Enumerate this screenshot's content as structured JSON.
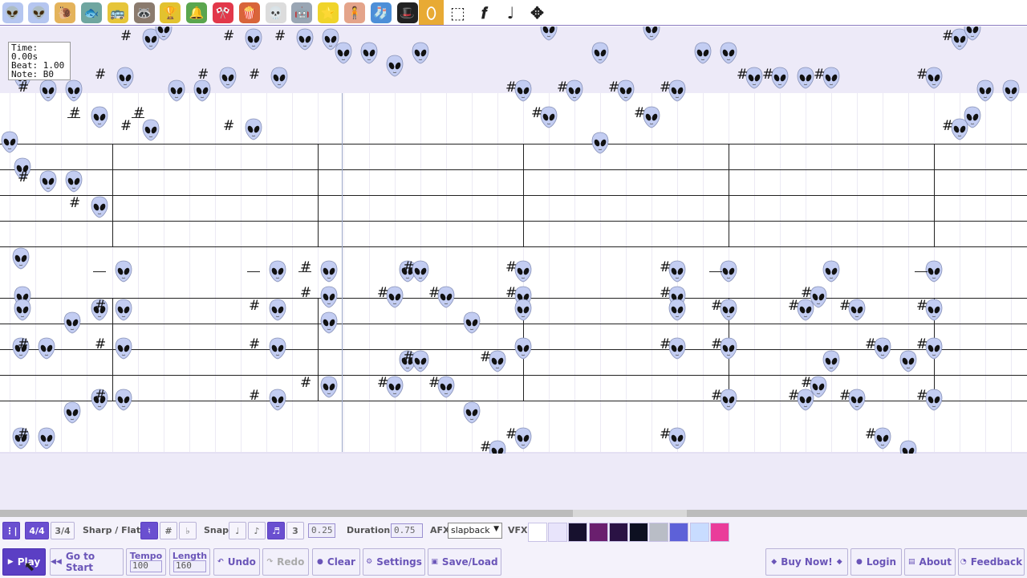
{
  "toolbar": {
    "instruments": [
      {
        "name": "alien-icon",
        "glyph": "👽",
        "color": "#b5c6f0"
      },
      {
        "name": "alien-icon",
        "glyph": "👽",
        "color": "#b5c6f0"
      },
      {
        "name": "snail-icon",
        "glyph": "🐌",
        "color": "#e4b35b"
      },
      {
        "name": "fish-icon",
        "glyph": "🐟",
        "color": "#6fa6a0"
      },
      {
        "name": "car-icon",
        "glyph": "🚌",
        "color": "#e6c53a"
      },
      {
        "name": "raccoon-icon",
        "glyph": "🦝",
        "color": "#8b7b6e"
      },
      {
        "name": "trophy-icon",
        "glyph": "🏆",
        "color": "#e2c22f"
      },
      {
        "name": "bell-icon",
        "glyph": "🔔",
        "color": "#5aa64e"
      },
      {
        "name": "flag-icon",
        "glyph": "🎌",
        "color": "#e2384a"
      },
      {
        "name": "popcorn-icon",
        "glyph": "🍿",
        "color": "#d8643a"
      },
      {
        "name": "skull-icon",
        "glyph": "💀",
        "color": "#dcdcdc"
      },
      {
        "name": "robot-icon",
        "glyph": "🤖",
        "color": "#9aa6b4"
      },
      {
        "name": "star-icon",
        "glyph": "⭐",
        "color": "#f0d42a"
      },
      {
        "name": "girl-icon",
        "glyph": "🧍",
        "color": "#e4a48a"
      },
      {
        "name": "sock-icon",
        "glyph": "🧦",
        "color": "#4d8fd8"
      },
      {
        "name": "hat-icon",
        "glyph": "🎩",
        "color": "#222222"
      }
    ],
    "tools": [
      {
        "name": "eraser-icon",
        "glyph": "⬯",
        "selected": true
      },
      {
        "name": "select-box-icon",
        "glyph": "⬚",
        "selected": false
      },
      {
        "name": "forte-icon",
        "glyph": "𝒇",
        "selected": false
      },
      {
        "name": "tie-note-icon",
        "glyph": "♩",
        "selected": false
      },
      {
        "name": "move-icon",
        "glyph": "✥",
        "selected": false
      }
    ]
  },
  "info": {
    "time": "Time: 0.00s",
    "beat": "Beat: 1.00",
    "note": "Note: B0"
  },
  "controls": {
    "time_signatures": [
      "4/4",
      "3/4"
    ],
    "active_time_signature": "4/4",
    "sharp_flat_label": "Sharp / Flat",
    "accidentals": [
      "♮",
      "#",
      "♭"
    ],
    "snap_label": "Snap",
    "snap_options": [
      "♩",
      "♪",
      "♬",
      "3"
    ],
    "snap_value": "0.25",
    "duration_label": "Duration",
    "duration_value": "0.75",
    "afx_label": "AFX",
    "afx_value": "slapback",
    "vfx_label": "VFX",
    "vfx_swatches": [
      "#ffffff",
      "#e8e4fb",
      "#17112e",
      "#6a1f6e",
      "#2a1244",
      "#0d1021",
      "#b9bdc6",
      "#5d61d8",
      "#c8dcff",
      "#ea3c9a"
    ]
  },
  "buttons": {
    "play": "Play",
    "go_to_start": "Go to Start",
    "tempo_label": "Tempo",
    "tempo_value": "100",
    "length_label": "Length",
    "length_value": "160",
    "undo": "Undo",
    "redo": "Redo",
    "clear": "Clear",
    "settings": "Settings",
    "save_load": "Save/Load",
    "buy_now": "Buy Now!",
    "login": "Login",
    "about": "About",
    "feedback": "Feedback"
  },
  "colors": {
    "accent": "#5b3fc4",
    "alien": "#c3cdf2",
    "selected_tool": "#e8aa34"
  }
}
